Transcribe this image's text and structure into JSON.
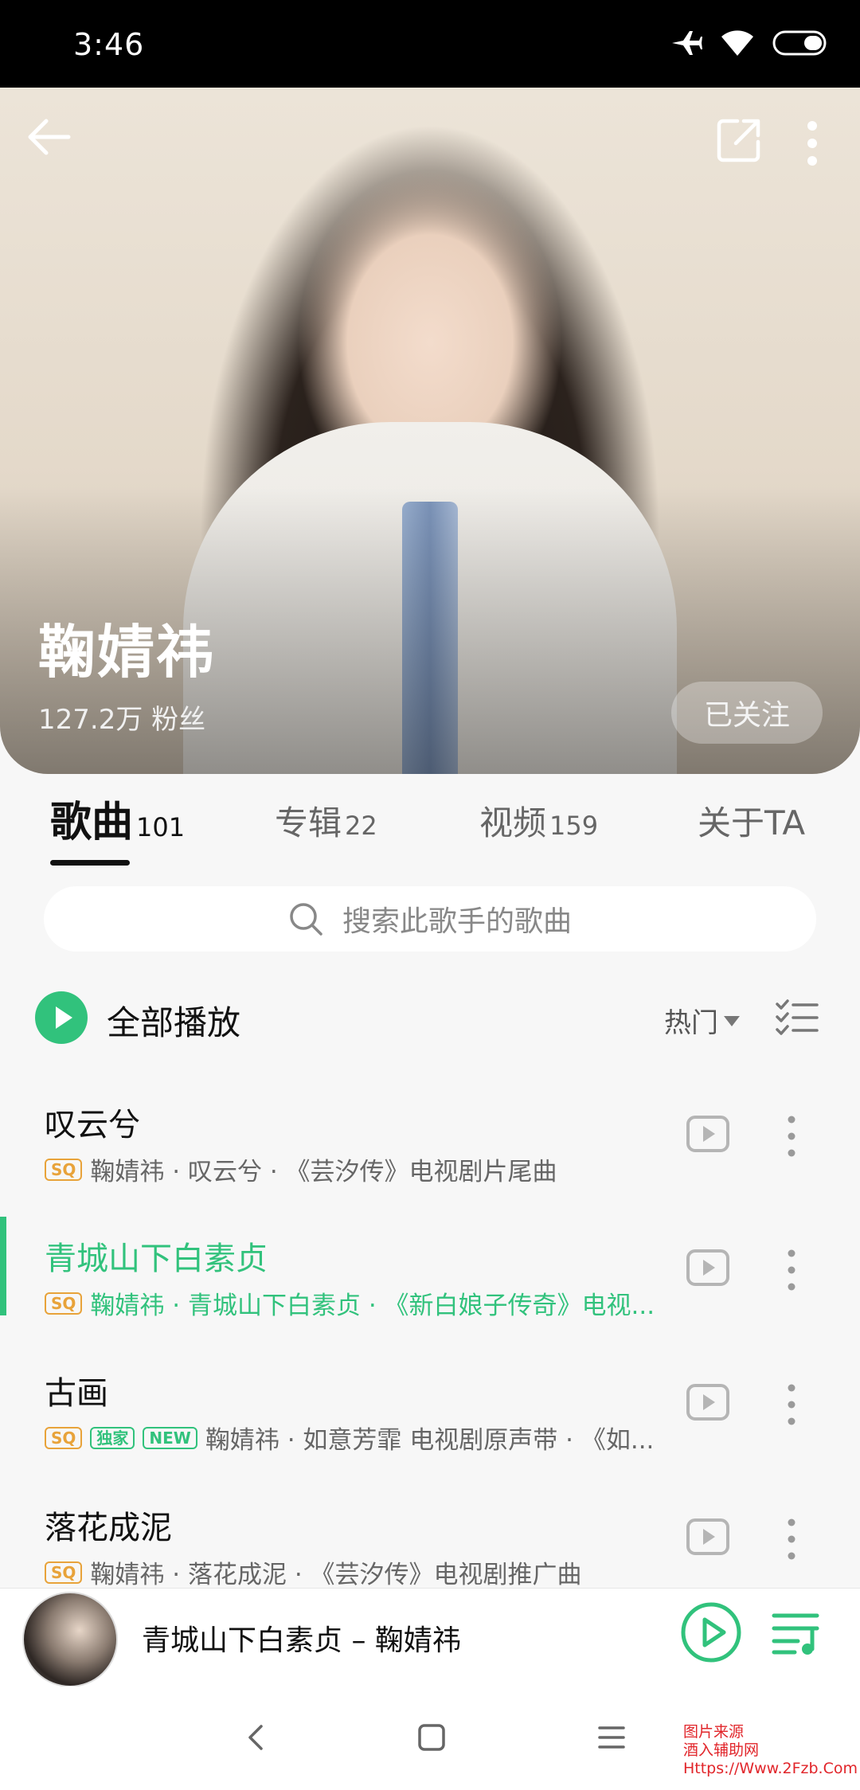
{
  "status_bar": {
    "time": "3:46",
    "icons": [
      "airplane-icon",
      "wifi-icon",
      "battery-icon"
    ]
  },
  "artist": {
    "name": "鞠婧祎",
    "fans": "127.2万 粉丝",
    "follow_label": "已关注"
  },
  "tabs": [
    {
      "label": "歌曲",
      "count": "101",
      "active": true
    },
    {
      "label": "专辑",
      "count": "22"
    },
    {
      "label": "视频",
      "count": "159"
    },
    {
      "label": "关于TA",
      "count": ""
    }
  ],
  "search": {
    "placeholder": "搜索此歌手的歌曲"
  },
  "play_all": {
    "label": "全部播放",
    "sort_label": "热门"
  },
  "songs": [
    {
      "title": "叹云兮",
      "badges": [
        "SQ"
      ],
      "meta": "鞠婧祎 · 叹云兮 · 《芸汐传》电视剧片尾曲"
    },
    {
      "title": "青城山下白素贞",
      "badges": [
        "SQ"
      ],
      "meta": "鞠婧祎 · 青城山下白素贞 · 《新白娘子传奇》电视...",
      "playing": true
    },
    {
      "title": "古画",
      "badges": [
        "SQ",
        "独家",
        "NEW"
      ],
      "meta": "鞠婧祎 · 如意芳霏 电视剧原声带 · 《如..."
    },
    {
      "title": "落花成泥",
      "badges": [
        "SQ"
      ],
      "meta": "鞠婧祎 · 落花成泥 · 《芸汐传》电视剧推广曲"
    }
  ],
  "player": {
    "now_playing": "青城山下白素贞 – 鞠婧祎"
  },
  "watermark": {
    "line1": "图片来源",
    "line2": "酒入辅助网",
    "line3": "Https://Www.2Fzb.Com"
  },
  "colors": {
    "accent": "#31c27c",
    "sq_badge": "#e8a33a"
  }
}
